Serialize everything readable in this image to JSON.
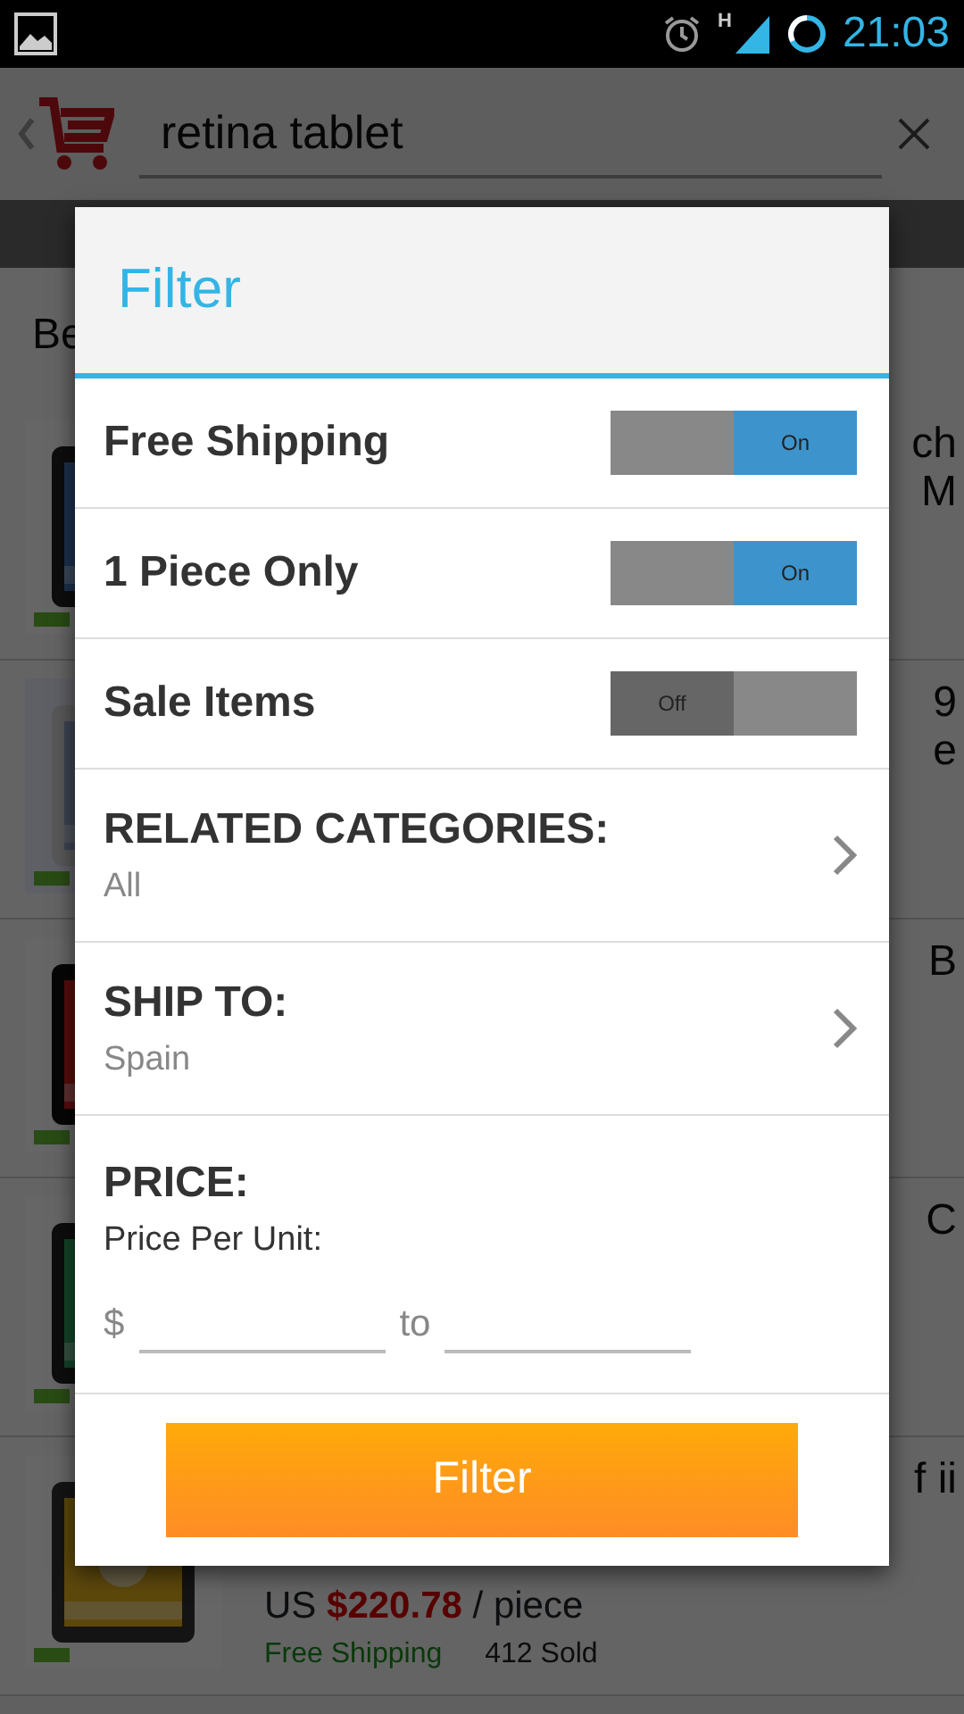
{
  "status_bar": {
    "time": "21:03",
    "network": "H"
  },
  "search": {
    "value": "retina tablet"
  },
  "sort_tab": {
    "label": "Be"
  },
  "products": [
    {
      "title_fragments": [
        "ch",
        "M"
      ]
    },
    {
      "title_fragments": [
        "9",
        "e"
      ]
    },
    {
      "title_fragments": [
        "B"
      ]
    },
    {
      "title_fragments": [
        "C"
      ]
    },
    {
      "title_fragments": [
        "f ii"
      ],
      "currency": "US",
      "price": "$220.78",
      "unit": "/ piece",
      "shipping": "Free Shipping",
      "sold": "412 Sold"
    }
  ],
  "dialog": {
    "title": "Filter",
    "toggles": [
      {
        "label": "Free Shipping",
        "on": true,
        "state_label": "On"
      },
      {
        "label": "1 Piece Only",
        "on": true,
        "state_label": "On"
      },
      {
        "label": "Sale Items",
        "on": false,
        "state_label": "Off"
      }
    ],
    "choices": [
      {
        "label": "RELATED CATEGORIES:",
        "value": "All"
      },
      {
        "label": "SHIP TO:",
        "value": "Spain"
      }
    ],
    "price": {
      "label": "PRICE:",
      "sublabel": "Price Per Unit:",
      "currency": "$",
      "separator": "to"
    },
    "button": "Filter"
  }
}
